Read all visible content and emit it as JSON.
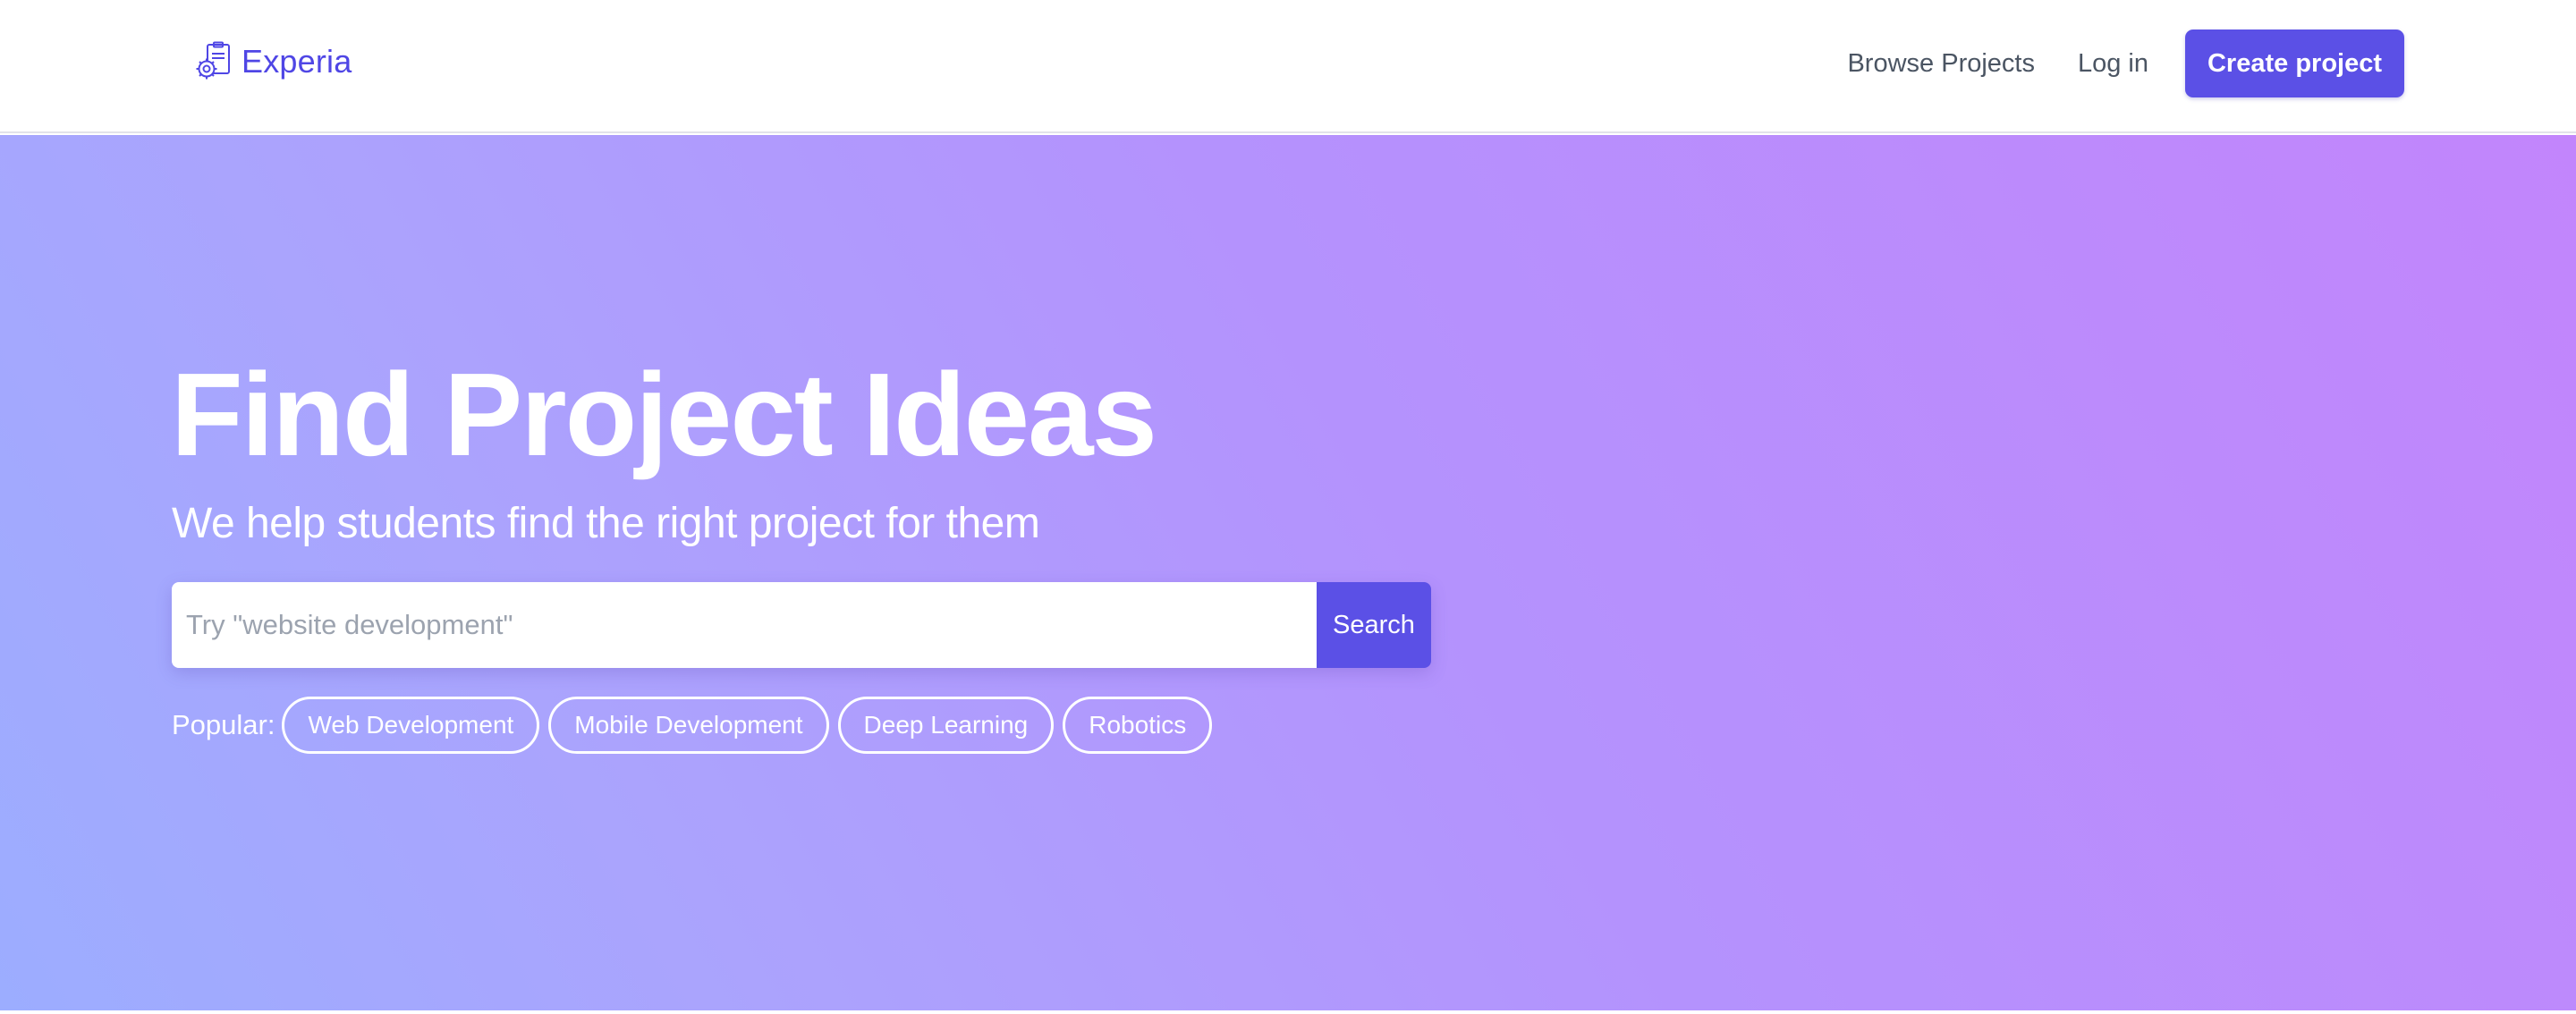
{
  "header": {
    "brand": {
      "name": "Experia",
      "icon": "gear-clipboard-icon",
      "color": "#4f46e5"
    },
    "nav": {
      "browse_label": "Browse Projects",
      "login_label": "Log in",
      "create_label": "Create project"
    }
  },
  "hero": {
    "title": "Find Project Ideas",
    "subtitle": "We help students find the right project for them",
    "search": {
      "placeholder": "Try \"website development\"",
      "value": "",
      "button_label": "Search"
    },
    "popular": {
      "label": "Popular:",
      "tags": [
        "Web Development",
        "Mobile Development",
        "Deep Learning",
        "Robotics"
      ]
    }
  },
  "colors": {
    "accent": "#5b50e6",
    "gradient_start": "#9cadff",
    "gradient_end": "#c285fc"
  }
}
